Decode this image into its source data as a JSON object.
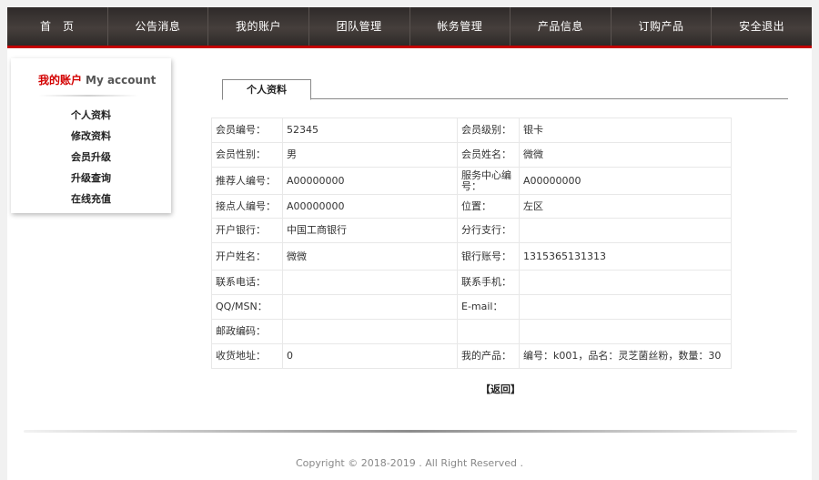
{
  "nav": {
    "items": [
      {
        "label": "首　页"
      },
      {
        "label": "公告消息"
      },
      {
        "label": "我的账户"
      },
      {
        "label": "团队管理"
      },
      {
        "label": "帐务管理"
      },
      {
        "label": "产品信息"
      },
      {
        "label": "订购产品"
      },
      {
        "label": "安全退出"
      }
    ]
  },
  "sidebar": {
    "title_cn": "我的账户",
    "title_en": "My account",
    "items": [
      {
        "label": "个人资料"
      },
      {
        "label": "修改资料"
      },
      {
        "label": "会员升级"
      },
      {
        "label": "升级查询"
      },
      {
        "label": "在线充值"
      }
    ]
  },
  "main": {
    "tab_label": "个人资料",
    "rows": [
      {
        "l1": "会员编号：",
        "v1": "52345",
        "l2": "会员级别：",
        "v2": "银卡"
      },
      {
        "l1": "会员性别：",
        "v1": "男",
        "l2": "会员姓名：",
        "v2": "微微"
      },
      {
        "l1": "推荐人编号：",
        "v1": "A00000000",
        "l2": "服务中心编号：",
        "v2": "A00000000"
      },
      {
        "l1": "接点人编号：",
        "v1": "A00000000",
        "l2": "位置：",
        "v2": "左区"
      },
      {
        "l1": "开户银行：",
        "v1": "中国工商银行",
        "l2": "分行支行：",
        "v2": ""
      },
      {
        "l1": "开户姓名：",
        "v1": "微微",
        "l2": "银行账号：",
        "v2": "1315365131313"
      },
      {
        "l1": "联系电话：",
        "v1": "",
        "l2": "联系手机：",
        "v2": ""
      },
      {
        "l1": "QQ/MSN：",
        "v1": "",
        "l2": "E-mail：",
        "v2": ""
      },
      {
        "l1": "邮政编码：",
        "v1": "",
        "l2": "",
        "v2": ""
      },
      {
        "l1": "收货地址：",
        "v1": "0",
        "l2": "我的产品：",
        "v2": "编号：k001，品名：灵芝菌丝粉，数量：30"
      }
    ],
    "back_label": "【返回】"
  },
  "footer": {
    "copyright": "Copyright © 2018-2019 . All Right Reserved ."
  },
  "colors": {
    "nav_bg": "#3a3432",
    "accent_red": "#c30000",
    "sidebar_title_red": "#d30000"
  }
}
